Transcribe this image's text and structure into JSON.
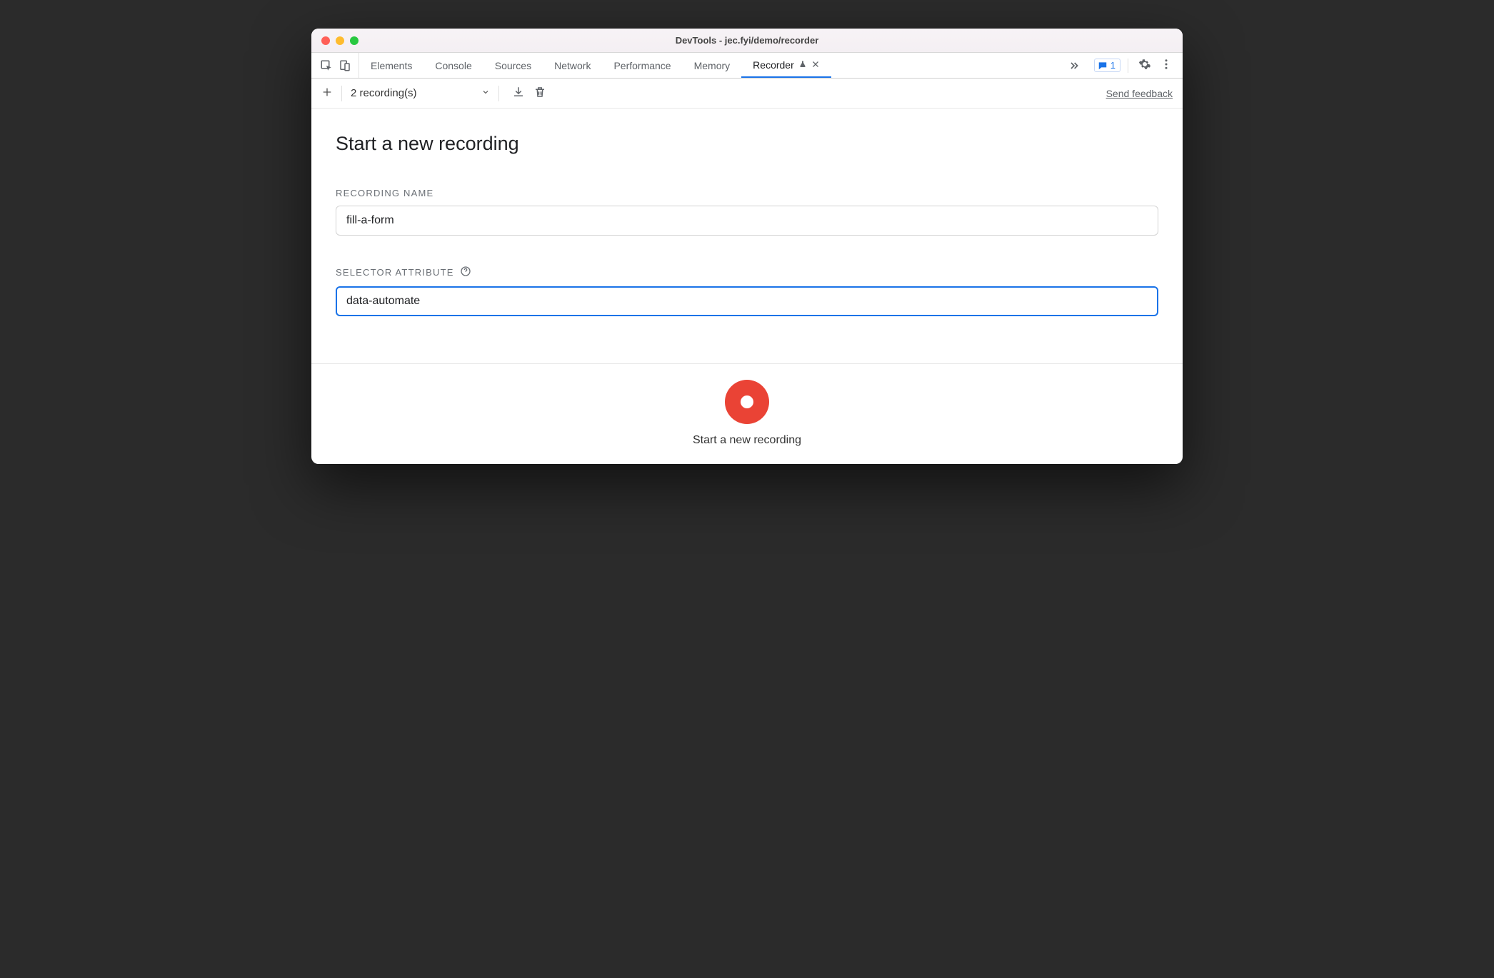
{
  "window": {
    "title": "DevTools - jec.fyi/demo/recorder"
  },
  "tabs": {
    "items": [
      {
        "label": "Elements",
        "active": false
      },
      {
        "label": "Console",
        "active": false
      },
      {
        "label": "Sources",
        "active": false
      },
      {
        "label": "Network",
        "active": false
      },
      {
        "label": "Performance",
        "active": false
      },
      {
        "label": "Memory",
        "active": false
      },
      {
        "label": "Recorder",
        "active": true,
        "experiment": true,
        "closable": true
      }
    ],
    "issues_count": "1"
  },
  "recorder_toolbar": {
    "recordings_label": "2 recording(s)"
  },
  "feedback_link": "Send feedback",
  "main": {
    "heading": "Start a new recording",
    "recording_name_label": "Recording Name",
    "recording_name_value": "fill-a-form",
    "selector_attribute_label": "Selector Attribute",
    "selector_attribute_value": "data-automate"
  },
  "footer": {
    "button_label": "Start a new recording"
  }
}
